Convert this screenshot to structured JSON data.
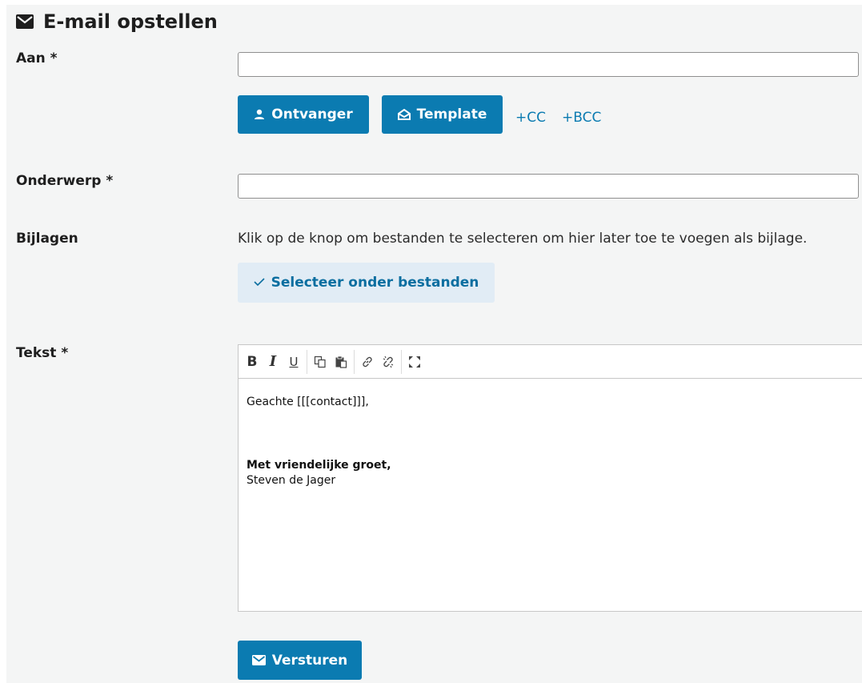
{
  "header": {
    "title": "E-mail opstellen",
    "icon": "envelope-icon"
  },
  "to": {
    "label": "Aan *",
    "value": "",
    "placeholder": ""
  },
  "recipient_buttons": {
    "recipient_label": "Ontvanger",
    "template_label": "Template",
    "cc_label": "+CC",
    "bcc_label": "+BCC"
  },
  "subject": {
    "label": "Onderwerp *",
    "value": "",
    "placeholder": ""
  },
  "attachments": {
    "label": "Bijlagen",
    "hint": "Klik op de knop om bestanden te selecteren om hier later toe te voegen als bijlage.",
    "select_label": "Selecteer onder bestanden"
  },
  "body": {
    "label": "Tekst *",
    "toolbar": {
      "bold": "B",
      "italic": "I",
      "underline": "U",
      "icons": [
        "copy-icon",
        "paste-icon",
        "link-icon",
        "unlink-icon",
        "maximize-icon"
      ]
    },
    "content": {
      "greeting": "Geachte [[[contact]]],",
      "closing": "Met vriendelijke groet,",
      "signature": "Steven de Jager"
    }
  },
  "submit": {
    "label": "Versturen"
  },
  "colors": {
    "primary": "#0b7bb1",
    "panel_bg": "#f4f5f5",
    "light_button_bg": "#e1ecf5"
  }
}
